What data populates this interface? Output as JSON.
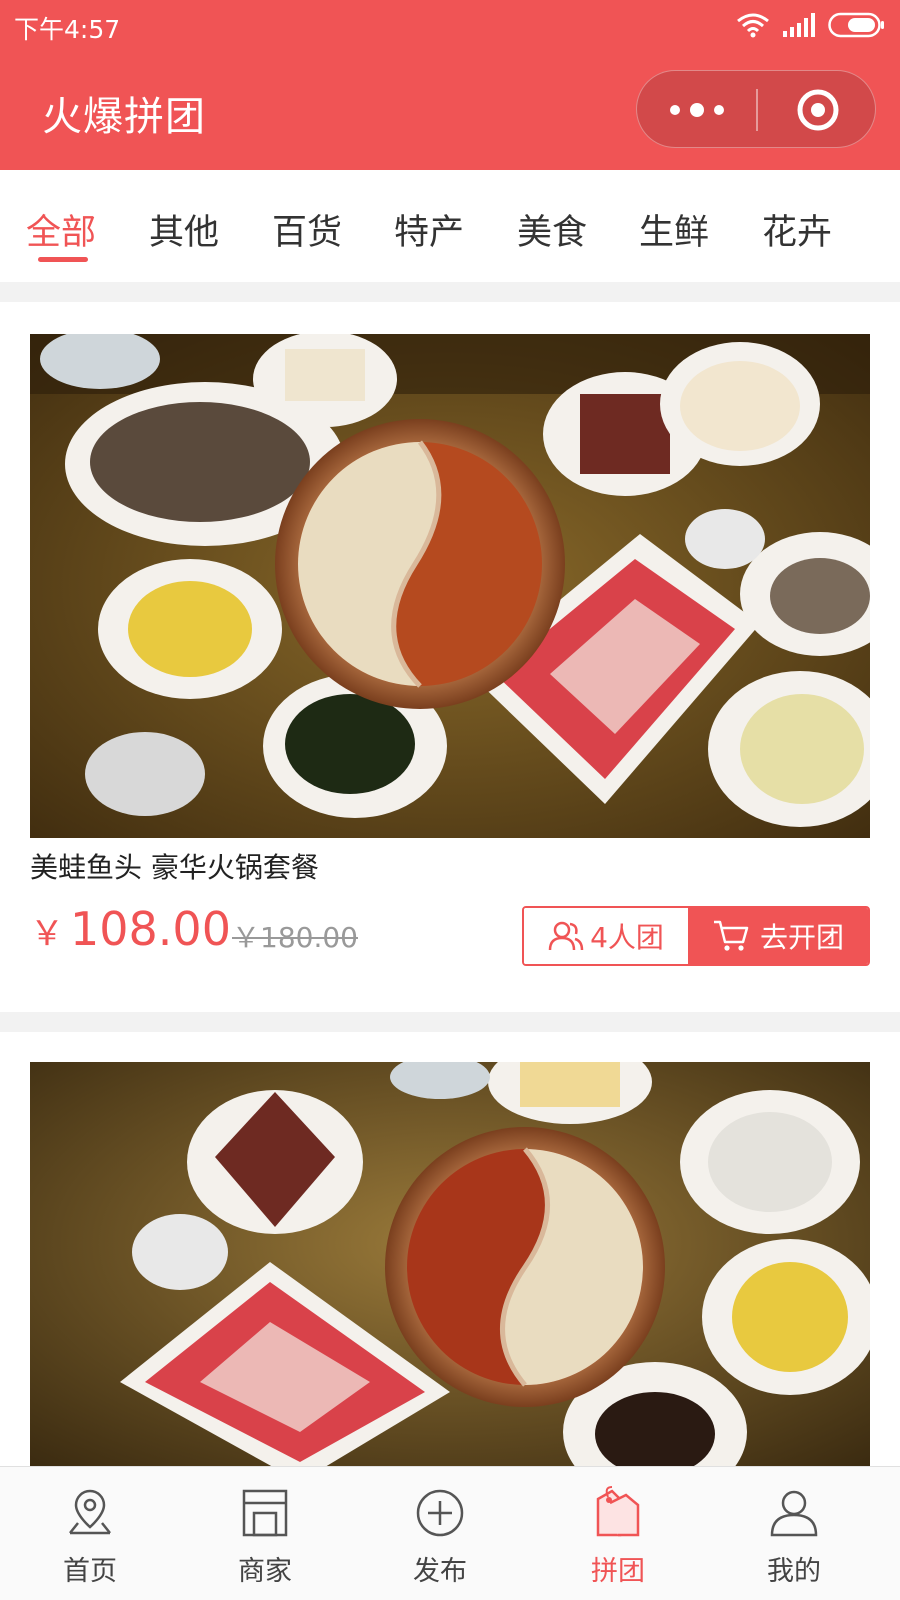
{
  "status_bar": {
    "time": "下午4:57"
  },
  "header": {
    "title": "火爆拼团"
  },
  "categories": [
    {
      "label": "全部",
      "active": true
    },
    {
      "label": "其他"
    },
    {
      "label": "百货"
    },
    {
      "label": "特产"
    },
    {
      "label": "美食"
    },
    {
      "label": "生鲜"
    },
    {
      "label": "花卉"
    }
  ],
  "products": [
    {
      "title": "美蛙鱼头 豪华火锅套餐",
      "currency": "￥",
      "price": "108.00",
      "original_price": "￥180.00",
      "group_size": "4人团",
      "action": "去开团"
    }
  ],
  "tabbar": [
    {
      "label": "首页",
      "icon": "location-pin-icon"
    },
    {
      "label": "商家",
      "icon": "store-icon"
    },
    {
      "label": "发布",
      "icon": "add-circle-icon"
    },
    {
      "label": "拼团",
      "icon": "price-tag-icon",
      "active": true
    },
    {
      "label": "我的",
      "icon": "user-icon"
    }
  ],
  "colors": {
    "accent": "#f05455",
    "text": "#222222",
    "muted": "#999999",
    "background_gap": "#f2f2f2"
  }
}
